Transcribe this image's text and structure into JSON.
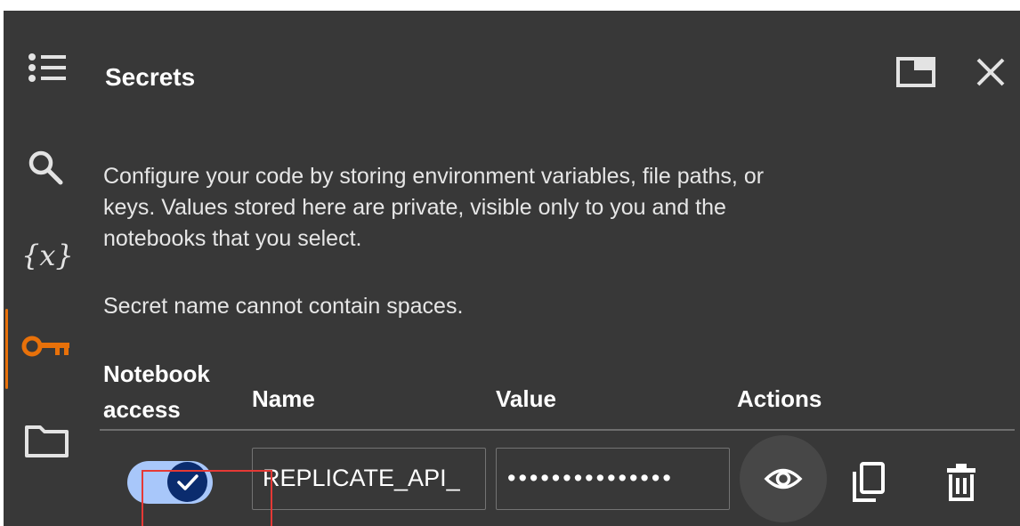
{
  "panel": {
    "title": "Secrets",
    "description": {
      "line1": "Configure your code by storing environment variables, file paths, or",
      "line2": "keys. Values stored here are private, visible only to you and the",
      "line3": "notebooks that you select."
    },
    "hint": "Secret name cannot contain spaces.",
    "accent_color": "#e8710a"
  },
  "toolbar": {
    "dock_icon": "dock-window-icon",
    "close_icon": "close-icon"
  },
  "rail": {
    "items": [
      {
        "icon": "table-of-contents-icon"
      },
      {
        "icon": "search-icon"
      },
      {
        "icon": "variables-icon",
        "glyph": "{x}"
      },
      {
        "icon": "key-icon",
        "active": true
      },
      {
        "icon": "folder-icon"
      }
    ]
  },
  "table": {
    "headers": {
      "access_line1": "Notebook",
      "access_line2": "access",
      "name": "Name",
      "value": "Value",
      "actions": "Actions"
    },
    "rows": [
      {
        "notebook_access": true,
        "name": "REPLICATE_API_",
        "value": "•••••••••••••••",
        "actions": [
          "eye-icon",
          "copy-icon",
          "delete-icon"
        ]
      }
    ]
  }
}
